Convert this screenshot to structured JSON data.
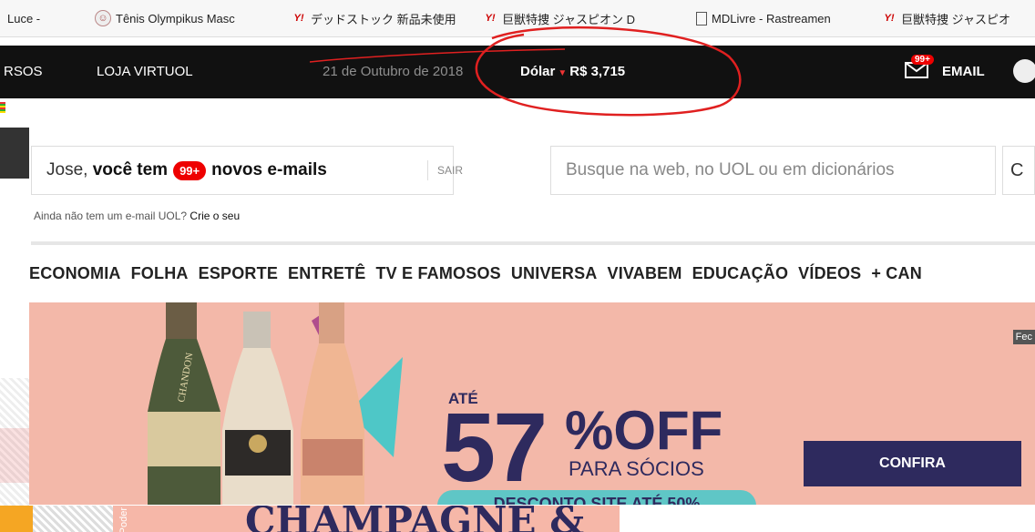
{
  "bookmarks": [
    {
      "label": "Luce -",
      "icon": "bookmark-icon"
    },
    {
      "label": "Tênis Olympikus Masc",
      "icon": "olympikus-icon"
    },
    {
      "label": "デッドストック 新品未使用",
      "icon": "yahoo-icon"
    },
    {
      "label": "巨獣特捜 ジャスピオン D",
      "icon": "yahoo-icon"
    },
    {
      "label": "MDLivre - Rastreamen",
      "icon": "page-icon"
    },
    {
      "label": "巨獣特捜 ジャスピオ",
      "icon": "yahoo-icon"
    }
  ],
  "topbar": {
    "recursos": "RSOS",
    "loja": "LOJA VIRTUOL",
    "date": "21 de Outubro de 2018",
    "dolar_label": "Dólar",
    "dolar_value": "R$ 3,715",
    "email_badge": "99+",
    "email_label": "EMAIL"
  },
  "email_box": {
    "greeting": "Jose,",
    "you_have": "você tem",
    "count": "99+",
    "new_emails": "novos e-mails",
    "logout": "SAIR",
    "no_account": "Ainda não tem um e-mail UOL?",
    "create": "Crie o seu"
  },
  "search": {
    "placeholder": "Busque na web, no UOL ou em dicionários",
    "button": "C"
  },
  "nav": [
    "ECONOMIA",
    "FOLHA",
    "ESPORTE",
    "ENTRETÊ",
    "TV E FAMOSOS",
    "UNIVERSA",
    "VIVABEM",
    "EDUCAÇÃO",
    "VÍDEOS",
    "+ CAN"
  ],
  "banner": {
    "close": "Fec",
    "ate": "ATÉ",
    "discount": "57",
    "off": "%OFF",
    "para_socios": "PARA SÓCIOS",
    "cta": "CONFIRA",
    "desconto": "DESCONTO SITE ATÉ 50%",
    "bottle_label": "CHANDON"
  },
  "below": {
    "headline": "CHAMPAGNE &",
    "vertical": "Poder"
  },
  "colors": {
    "accent": "#e00000",
    "brand_dark": "#2e2a5e",
    "banner_bg": "#f3b8a9",
    "annotation": "#e02020"
  }
}
